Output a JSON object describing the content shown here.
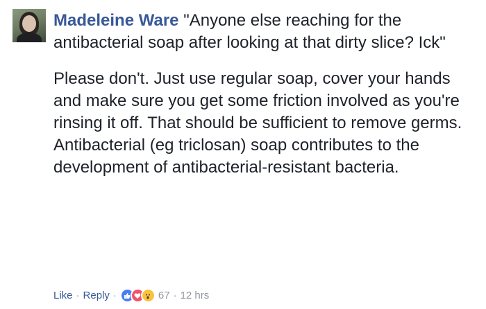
{
  "comment": {
    "author": "Madeleine Ware",
    "quote": "\"Anyone else reaching for the antibacterial soap after looking at that dirty slice? Ick\"",
    "paragraph_1": "Please don't. Just use regular soap, cover your hands and make sure you get some friction involved as you're rinsing it off. That should be sufficient to remove germs.",
    "paragraph_2": "Antibacterial (eg triclosan) soap contributes to the development of antibacterial-resistant bacteria."
  },
  "actions": {
    "like_label": "Like",
    "reply_label": "Reply",
    "separator": "·",
    "reaction_count": "67",
    "timestamp": "12 hrs",
    "reactions": [
      "like-icon",
      "love-icon",
      "wow-icon"
    ]
  },
  "colors": {
    "link": "#385898",
    "meta": "#90949c",
    "text": "#1d2129"
  }
}
